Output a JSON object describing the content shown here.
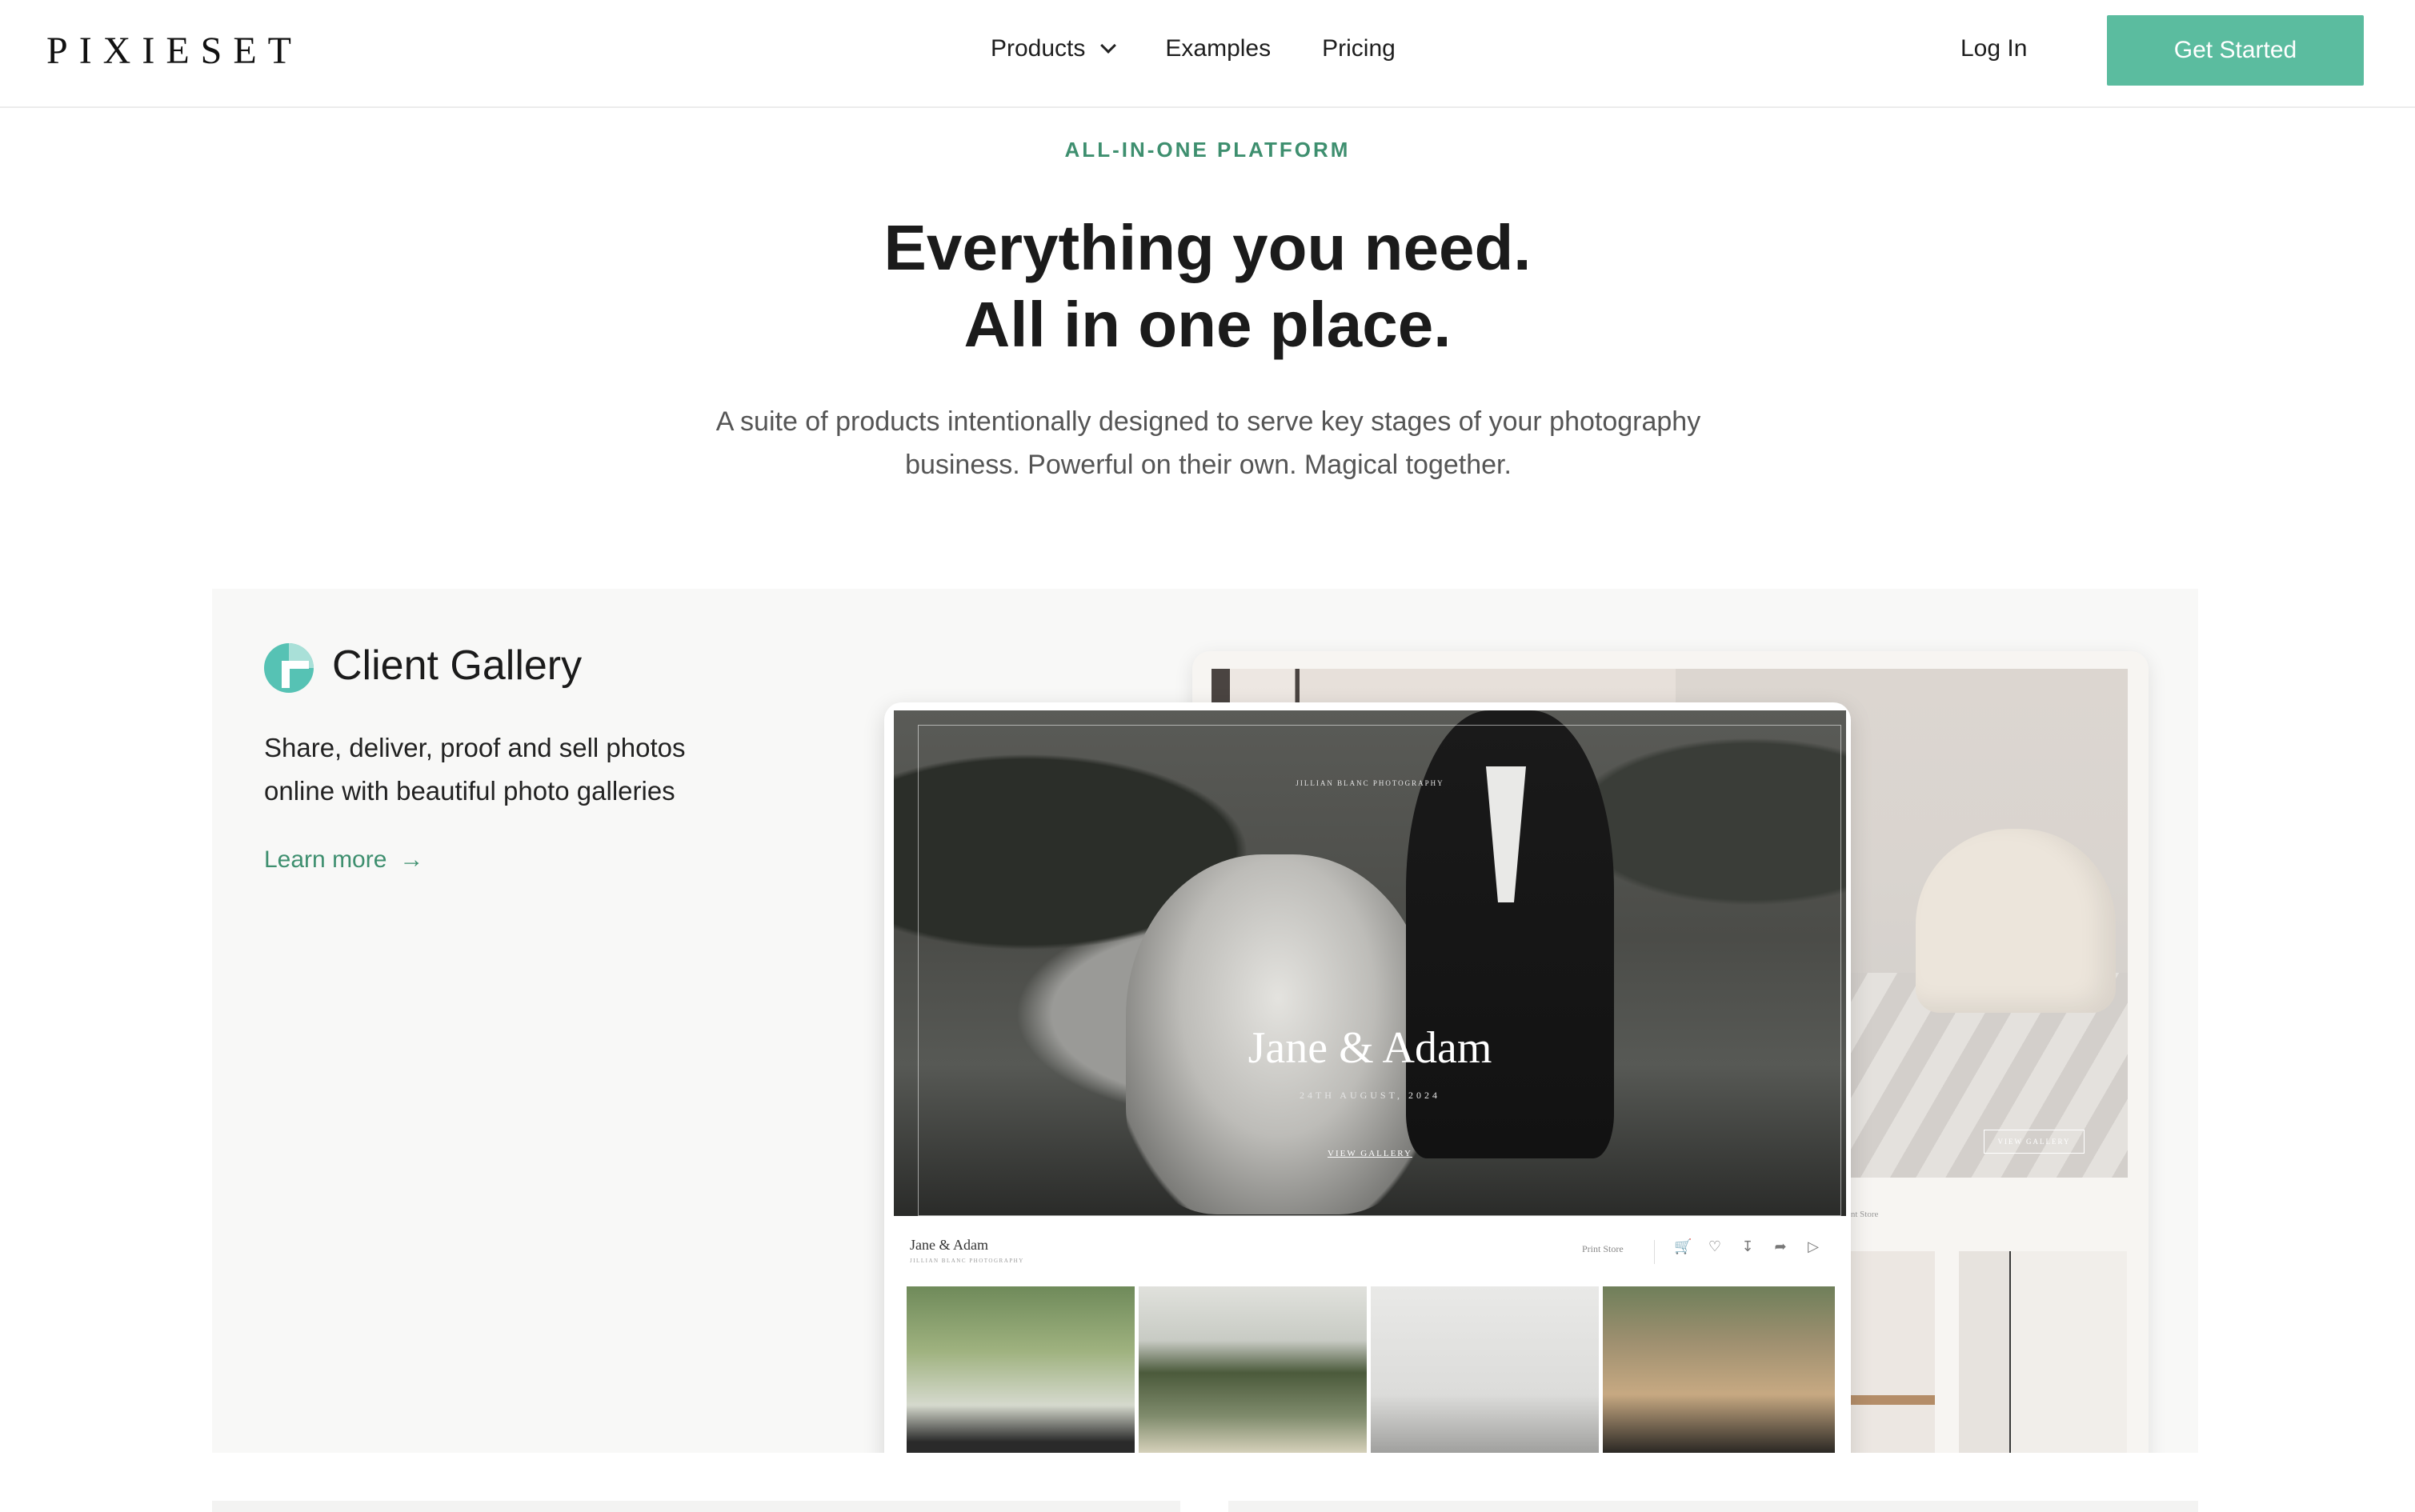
{
  "nav": {
    "logo": "PIXIESET",
    "links": [
      {
        "label": "Products"
      },
      {
        "label": "Examples"
      },
      {
        "label": "Pricing"
      }
    ],
    "login": "Log In",
    "cta": "Get Started"
  },
  "hero": {
    "eyebrow": "ALL-IN-ONE PLATFORM",
    "headline_line1": "Everything you need.",
    "headline_line2": "All in one place.",
    "subtext": "A suite of products intentionally designed to serve key stages of your photography business. Powerful on their own. Magical together."
  },
  "product": {
    "title": "Client Gallery",
    "description": "Share, deliver, proof and sell photos online with beautiful photo galleries",
    "learn_more": "Learn more",
    "accent_color": "#3e8f6f",
    "icon": "client-gallery-logo-icon"
  },
  "mockup": {
    "studio": "JILLIAN BLANC PHOTOGRAPHY",
    "couple": "Jane & Adam",
    "date": "24TH AUGUST, 2024",
    "view_gallery": "VIEW GALLERY",
    "gallery_title": "Jane & Adam",
    "gallery_sub": "JILLIAN BLANC PHOTOGRAPHY",
    "print_store": "Print Store",
    "back_view_gallery": "VIEW GALLERY",
    "back_print_store": "Print Store",
    "icons": [
      "cart-icon",
      "heart-icon",
      "download-icon",
      "share-icon",
      "play-icon"
    ]
  },
  "colors": {
    "brand_green": "#5bbc9f",
    "eyebrow_green": "#3e8f6f"
  }
}
